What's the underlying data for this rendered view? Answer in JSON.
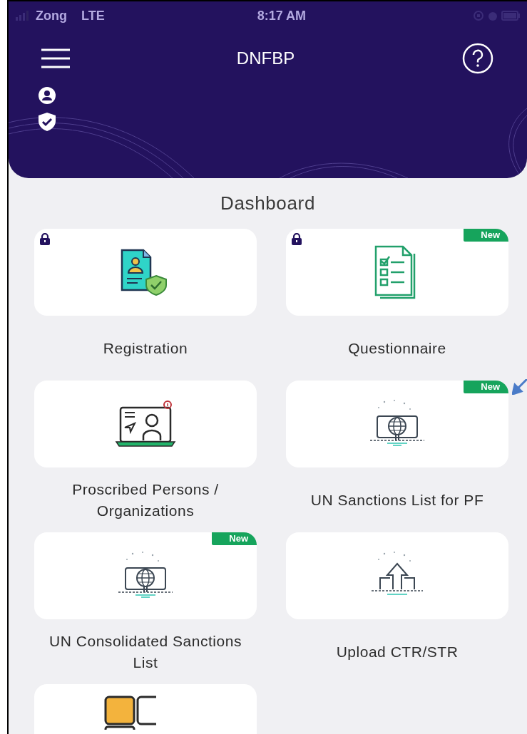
{
  "status_bar": {
    "carrier": "Zong",
    "network": "LTE",
    "time": "8:17 AM"
  },
  "header": {
    "title": "DNFBP"
  },
  "page_title": "Dashboard",
  "tiles": [
    {
      "label": "Registration",
      "locked": true
    },
    {
      "label": "Questionnaire",
      "locked": true,
      "new_badge": "New"
    },
    {
      "label": "Proscribed Persons / Organizations",
      "locked": false
    },
    {
      "label": "UN Sanctions List for PF",
      "locked": false,
      "new_badge": "New"
    },
    {
      "label": "UN Consolidated Sanctions List",
      "locked": false,
      "new_badge": "New"
    },
    {
      "label": "Upload CTR/STR",
      "locked": false
    },
    {
      "locked": false
    }
  ]
}
